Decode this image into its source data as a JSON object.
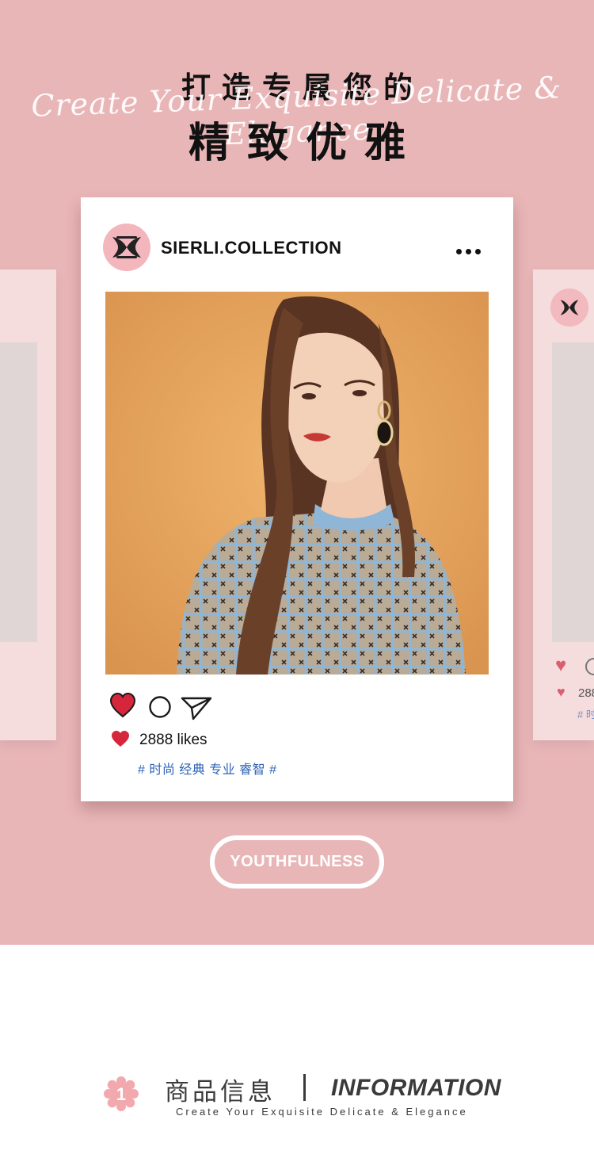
{
  "hero": {
    "headline_line1": "打造专属您的",
    "script_line": "Create Your Exquisite Delicate & Elegance",
    "headline_line2": "精致优雅",
    "background_color": "#e9b6b8"
  },
  "post": {
    "account_name": "SIERLI.COLLECTION",
    "more_icon": "more-horizontal-icon",
    "likes": "2888 likes",
    "hashtags": "# 时尚 经典 专业 睿智 #",
    "actions": [
      "heart-icon",
      "comment-icon",
      "share-icon"
    ],
    "like_color": "#d6263c",
    "hashtag_color": "#2d63b4"
  },
  "side_card": {
    "likes_partial": "288",
    "tags_partial": "# 时"
  },
  "badge": {
    "label": "YOUTHFULNESS"
  },
  "info": {
    "number": "1",
    "title_cn": "商品信息",
    "separator": "|",
    "title_en": "INFORMATION",
    "subtitle": "Create Your Exquisite Delicate & Elegance",
    "badge_color": "#f2a9ad"
  }
}
